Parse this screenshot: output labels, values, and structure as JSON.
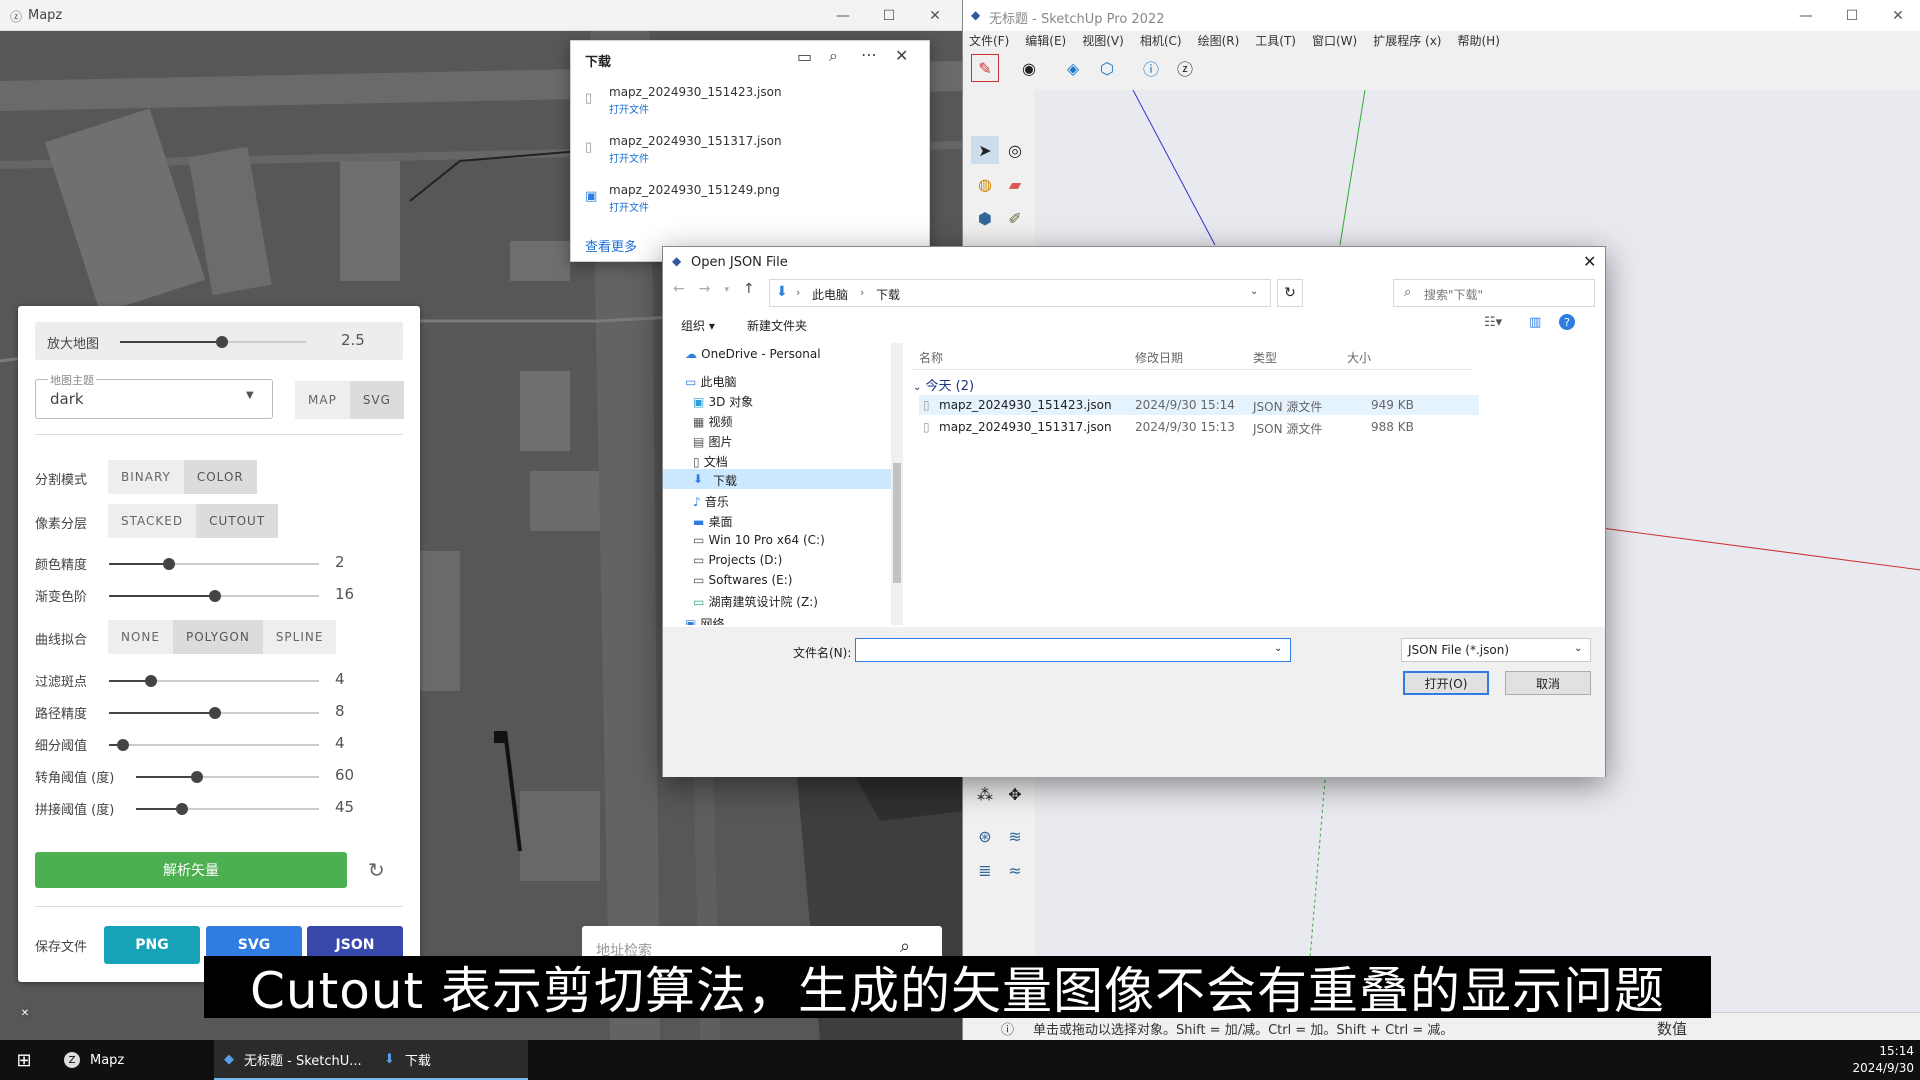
{
  "mapz": {
    "title": "Mapz",
    "panel": {
      "zoom_label": "放大地图",
      "zoom_value": "2.5",
      "zoom_level": 0.55,
      "theme_label": "地图主题",
      "theme_value": "dark",
      "view_buttons": [
        "MAP",
        "SVG"
      ],
      "split_mode_label": "分割模式",
      "split_mode_options": [
        "BINARY",
        "COLOR"
      ],
      "pixel_layer_label": "像素分层",
      "pixel_layer_options": [
        "STACKED",
        "CUTOUT"
      ],
      "color_precision_label": "颜色精度",
      "color_precision_value": "2",
      "gradient_label": "渐变色阶",
      "gradient_value": "16",
      "curve_fit_label": "曲线拟合",
      "curve_fit_options": [
        "NONE",
        "POLYGON",
        "SPLINE"
      ],
      "filter_speckle_label": "过滤斑点",
      "filter_speckle_value": "4",
      "path_precision_label": "路径精度",
      "path_precision_value": "8",
      "subdivide_label": "细分阈值",
      "subdivide_value": "4",
      "corner_label": "转角阈值 (度)",
      "corner_value": "60",
      "splice_label": "拼接阈值 (度)",
      "splice_value": "45",
      "parse_button": "解析矢量",
      "save_label": "保存文件",
      "save_png": "PNG",
      "save_svg": "SVG",
      "save_json": "JSON"
    },
    "address_search": "地址检索",
    "downloads": {
      "title": "下载",
      "files": [
        {
          "name": "mapz_2024930_151423.json",
          "link": "打开文件"
        },
        {
          "name": "mapz_2024930_151317.json",
          "link": "打开文件"
        },
        {
          "name": "mapz_2024930_151249.png",
          "link": "打开文件"
        }
      ],
      "see_more": "查看更多"
    }
  },
  "sketchup": {
    "title": "无标题 - SketchUp Pro 2022",
    "menu": [
      "文件(F)",
      "编辑(E)",
      "视图(V)",
      "相机(C)",
      "绘图(R)",
      "工具(T)",
      "窗口(W)",
      "扩展程序 (x)",
      "帮助(H)"
    ],
    "status_text": "单击或拖动以选择对象。Shift = 加/减。Ctrl = 加。Shift + Ctrl = 减。",
    "measure_label": "数值"
  },
  "dialog": {
    "title": "Open JSON File",
    "breadcrumb": [
      "此电脑",
      "下载"
    ],
    "search_placeholder": "搜索\"下载\"",
    "organize": "组织 ▾",
    "new_folder": "新建文件夹",
    "nav": [
      "OneDrive - Personal",
      "此电脑",
      "3D 对象",
      "视频",
      "图片",
      "文档",
      "下载",
      "音乐",
      "桌面",
      "Win 10 Pro x64 (C:)",
      "Projects (D:)",
      "Softwares (E:)",
      "湖南建筑设计院 (Z:)",
      "网络"
    ],
    "columns": [
      "名称",
      "修改日期",
      "类型",
      "大小"
    ],
    "group": "今天 (2)",
    "files": [
      {
        "name": "mapz_2024930_151423.json",
        "date": "2024/9/30 15:14",
        "type": "JSON 源文件",
        "size": "949 KB"
      },
      {
        "name": "mapz_2024930_151317.json",
        "date": "2024/9/30 15:13",
        "type": "JSON 源文件",
        "size": "988 KB"
      }
    ],
    "filename_label": "文件名(N):",
    "filename_value": "",
    "filetype": "JSON File (*.json)",
    "open_button": "打开(O)",
    "cancel_button": "取消"
  },
  "subtitle": "Cutout 表示剪切算法，生成的矢量图像不会有重叠的显示问题",
  "taskbar": {
    "items": [
      "Mapz",
      "无标题 - SketchU...",
      "下载"
    ],
    "time": "15:14",
    "date": "2024/9/30"
  },
  "colors": {
    "green": "#4caf50",
    "teal": "#17a2b8",
    "blue": "#2f7de1",
    "navy": "#3949ab"
  }
}
